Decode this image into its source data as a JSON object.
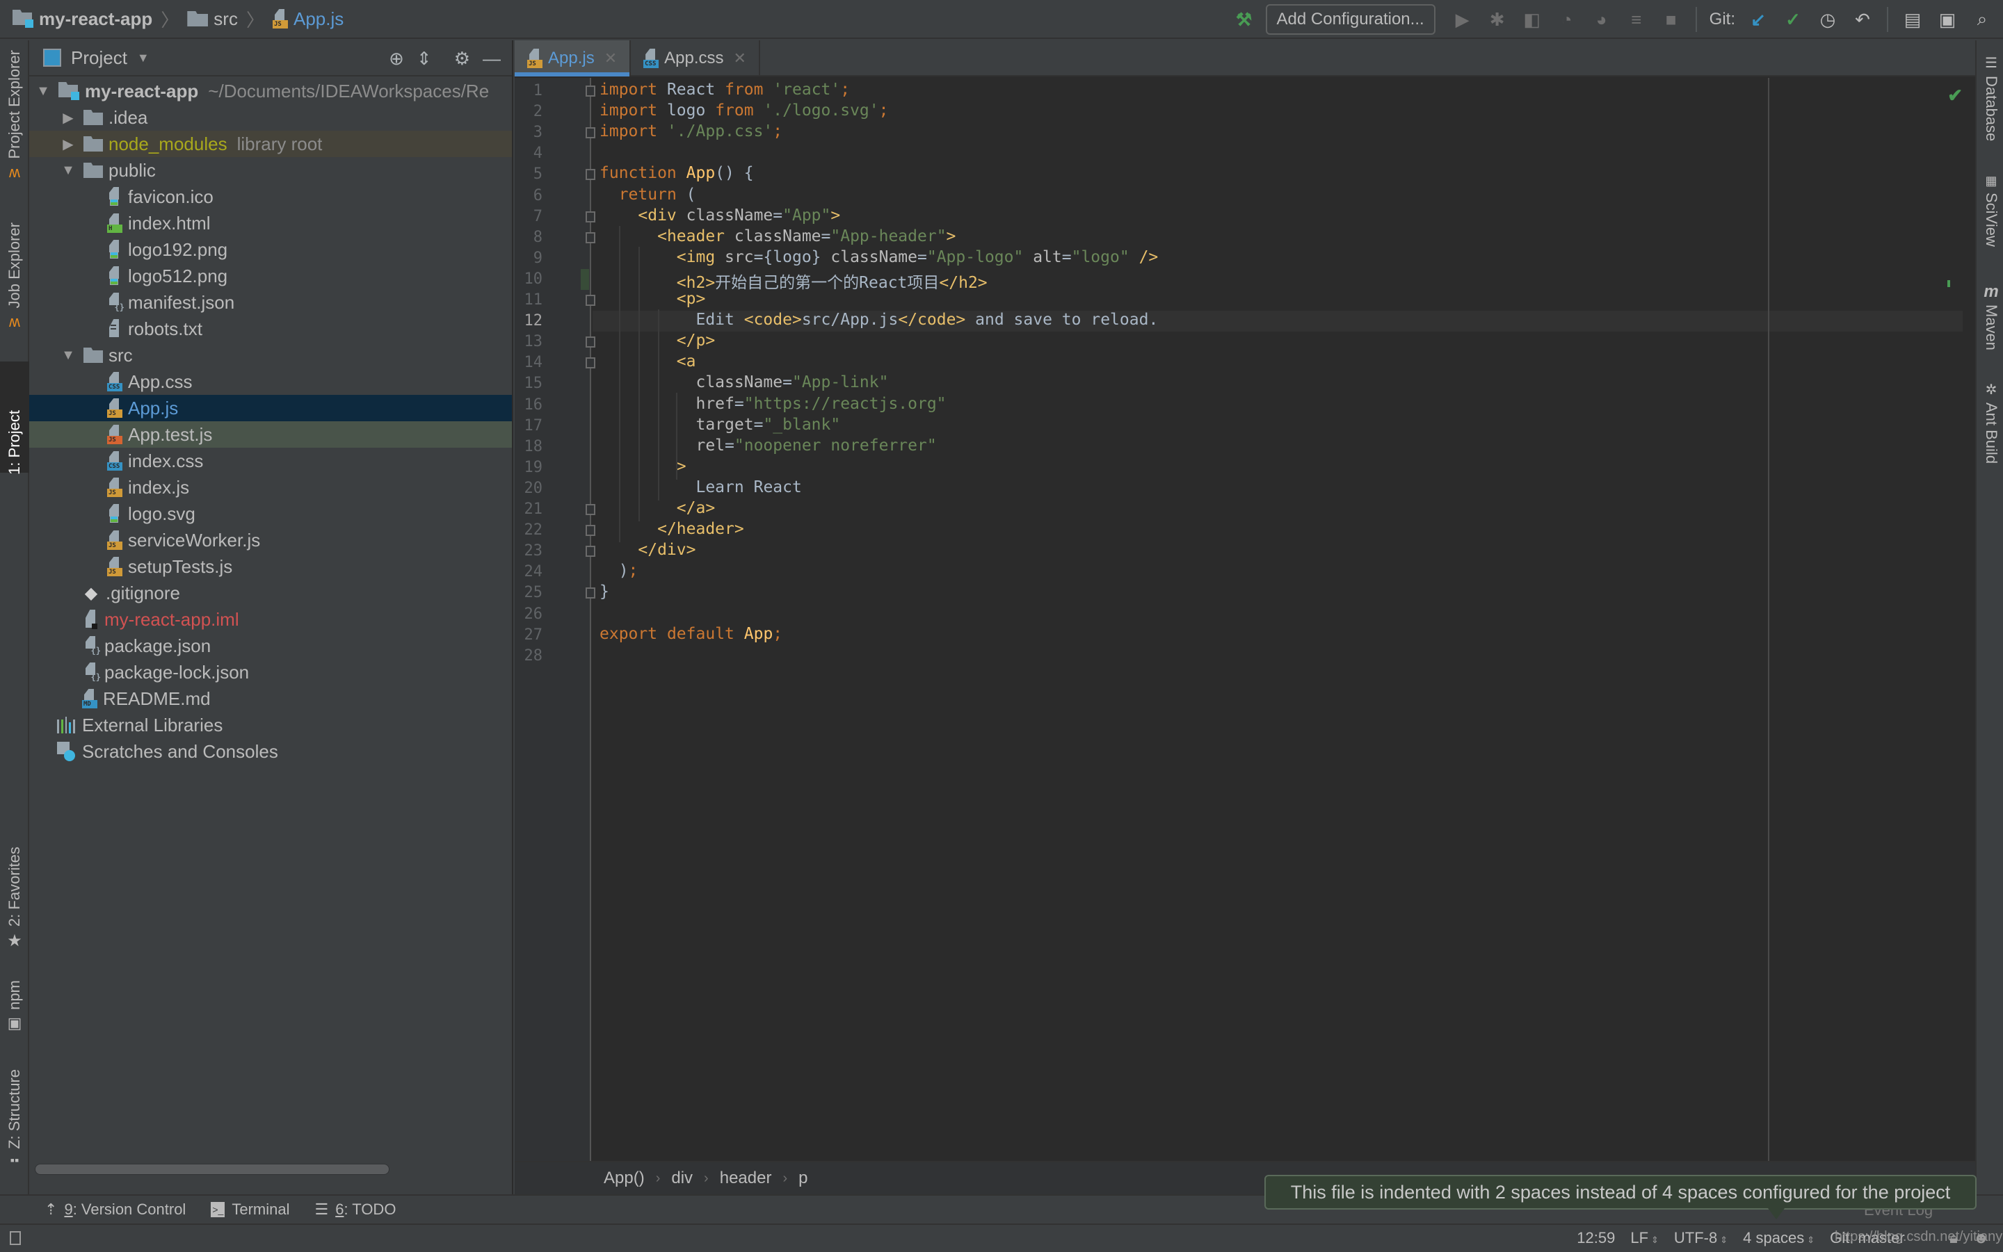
{
  "navbar": {
    "breadcrumbs": [
      "my-react-app",
      "src",
      "App.js"
    ],
    "add_configuration_label": "Add Configuration...",
    "git_label": "Git:"
  },
  "left_stripe": {
    "tabs": [
      "Project Explorer",
      "Job Explorer",
      "1: Project",
      "2: Favorites",
      "npm",
      "Z: Structure"
    ]
  },
  "project_panel": {
    "title": "Project",
    "tree": [
      {
        "name": "my-react-app",
        "hint": "~/Documents/IDEAWorkspaces/Re",
        "type": "project",
        "expanded": true
      },
      {
        "name": ".idea",
        "type": "folder",
        "expanded": false
      },
      {
        "name": "node_modules",
        "hint": "library root",
        "type": "folder",
        "expanded": false
      },
      {
        "name": "public",
        "type": "folder",
        "expanded": true
      },
      {
        "name": "favicon.ico",
        "type": "image"
      },
      {
        "name": "index.html",
        "type": "html"
      },
      {
        "name": "logo192.png",
        "type": "image"
      },
      {
        "name": "logo512.png",
        "type": "image"
      },
      {
        "name": "manifest.json",
        "type": "json"
      },
      {
        "name": "robots.txt",
        "type": "text"
      },
      {
        "name": "src",
        "type": "folder",
        "expanded": true
      },
      {
        "name": "App.css",
        "type": "css"
      },
      {
        "name": "App.js",
        "type": "js",
        "selected": true
      },
      {
        "name": "App.test.js",
        "type": "test"
      },
      {
        "name": "index.css",
        "type": "css"
      },
      {
        "name": "index.js",
        "type": "js"
      },
      {
        "name": "logo.svg",
        "type": "image"
      },
      {
        "name": "serviceWorker.js",
        "type": "js"
      },
      {
        "name": "setupTests.js",
        "type": "js"
      },
      {
        "name": ".gitignore",
        "type": "git"
      },
      {
        "name": "my-react-app.iml",
        "type": "iml"
      },
      {
        "name": "package.json",
        "type": "json"
      },
      {
        "name": "package-lock.json",
        "type": "json"
      },
      {
        "name": "README.md",
        "type": "md"
      },
      {
        "name": "External Libraries",
        "type": "libs"
      },
      {
        "name": "Scratches and Consoles",
        "type": "scratches"
      }
    ]
  },
  "editor": {
    "tabs": [
      {
        "label": "App.js",
        "type": "js",
        "active": true
      },
      {
        "label": "App.css",
        "type": "css",
        "active": false
      }
    ],
    "current_line": 12,
    "lines": [
      "import React from 'react';",
      "import logo from './logo.svg';",
      "import './App.css';",
      "",
      "function App() {",
      "  return (",
      "    <div className=\"App\">",
      "      <header className=\"App-header\">",
      "        <img src={logo} className=\"App-logo\" alt=\"logo\" />",
      "        <h2>开始自己的第一个的React项目</h2>",
      "        <p>",
      "          Edit <code>src/App.js</code> and save to reload.",
      "        </p>",
      "        <a",
      "          className=\"App-link\"",
      "          href=\"https://reactjs.org\"",
      "          target=\"_blank\"",
      "          rel=\"noopener noreferrer\"",
      "        >",
      "          Learn React",
      "        </a>",
      "      </header>",
      "    </div>",
      "  );",
      "}",
      "",
      "export default App;",
      ""
    ],
    "breadcrumb": [
      "App()",
      "div",
      "header",
      "p"
    ]
  },
  "right_stripe": {
    "tabs": [
      "Database",
      "SciView",
      "Maven",
      "Ant Build"
    ]
  },
  "bottom_bar": {
    "items": [
      {
        "key": "9",
        "label": ": Version Control"
      },
      {
        "key": "",
        "label": "Terminal"
      },
      {
        "key": "6",
        "label": ": TODO"
      }
    ]
  },
  "status_bar": {
    "position": "12:59",
    "line_separator": "LF",
    "encoding": "UTF-8",
    "indent": "4 spaces",
    "git_branch": "Git: master",
    "event_log": "Event Log",
    "watermark": "https://blog.csdn.net/yitianyz"
  },
  "tooltip": {
    "text": "This file is indented with 2 spaces instead of 4 spaces configured for the project"
  },
  "colors": {
    "accent": "#4a88c7",
    "selection": "#0d293e",
    "keyword": "#cc7832",
    "string": "#6a8759",
    "tag": "#e8bf6a",
    "ok_green": "#499c54"
  }
}
